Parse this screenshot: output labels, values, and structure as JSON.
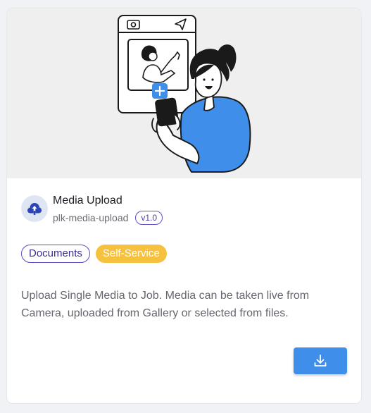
{
  "card": {
    "title": "Media Upload",
    "slug": "plk-media-upload",
    "version": "v1.0",
    "app_icon": "media-upload-icon",
    "hero_illustration": "woman-holding-phone-illustration",
    "tags": [
      "Documents",
      "Self-Service"
    ],
    "description": "Upload Single Media to Job. Media can be taken live from Camera, uploaded from Gallery or selected from files.",
    "download_button_icon": "download-icon"
  },
  "colors": {
    "accent": "#3e8eea",
    "tag_outline": "#5d4bc0",
    "tag_filled": "#f6c13f",
    "hero_background": "#efeff0"
  }
}
